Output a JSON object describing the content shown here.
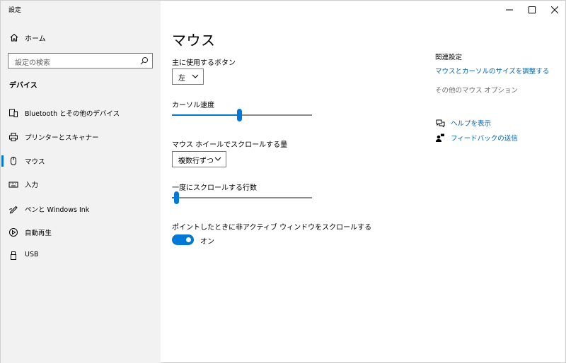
{
  "window": {
    "app_title": "設定",
    "controls": {
      "minimize": "minimize-icon",
      "maximize": "maximize-icon",
      "close": "close-icon"
    }
  },
  "sidebar": {
    "home_label": "ホーム",
    "search_placeholder": "設定の検索",
    "section_title": "デバイス",
    "items": [
      {
        "label": "Bluetooth とその他のデバイス",
        "icon": "bluetooth-devices-icon"
      },
      {
        "label": "プリンターとスキャナー",
        "icon": "printer-icon"
      },
      {
        "label": "マウス",
        "icon": "mouse-icon",
        "selected": true
      },
      {
        "label": "入力",
        "icon": "keyboard-icon"
      },
      {
        "label": "ペンと Windows Ink",
        "icon": "pen-icon"
      },
      {
        "label": "自動再生",
        "icon": "autoplay-icon"
      },
      {
        "label": "USB",
        "icon": "usb-icon"
      }
    ]
  },
  "main": {
    "title": "マウス",
    "primary_button": {
      "label": "主に使用するボタン",
      "value": "左"
    },
    "cursor_speed": {
      "label": "カーソル速度",
      "level": 0.48
    },
    "wheel_scroll": {
      "label": "マウス ホイールでスクロールする量",
      "value": "複数行ずつ"
    },
    "lines_per_scroll": {
      "label": "一度にスクロールする行数",
      "level": 0.03
    },
    "inactive_scroll": {
      "label": "ポイントしたときに非アクティブ ウィンドウをスクロールする",
      "state": "オン",
      "on": true
    }
  },
  "related": {
    "title": "関連設定",
    "mouse_cursor_link": "マウスとカーソルのサイズを調整する",
    "other_mouse_options": "その他のマウス オプション",
    "help_link": "ヘルプを表示",
    "feedback_link": "フィードバックの送信"
  },
  "colors": {
    "accent": "#0078d7",
    "link": "#0063b1",
    "sidebar_bg": "#f2f2f2"
  }
}
